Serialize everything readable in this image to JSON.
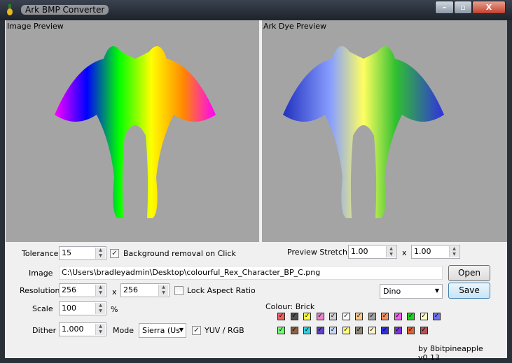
{
  "window": {
    "title": "Ark BMP Converter",
    "minimize": "–",
    "maximize": "▫",
    "close": "X"
  },
  "preview": {
    "image_label": "Image Preview",
    "dye_label": "Ark Dye Preview"
  },
  "controls": {
    "tolerance_label": "Tolerance",
    "tolerance": "15",
    "bg_removal_label": "Background removal on Click",
    "bg_removal_checked": true,
    "image_label": "Image",
    "image_path": "C:\\Users\\bradleyadmin\\Desktop\\colourful_Rex_Character_BP_C.png",
    "resolution_label": "Resolution",
    "res_w": "256",
    "x_label": "x",
    "res_h": "256",
    "lock_aspect_label": "Lock Aspect Ratio",
    "lock_aspect_checked": false,
    "scale_label": "Scale",
    "scale": "100",
    "percent": "%",
    "dither_label": "Dither",
    "dither": "1.000",
    "mode_label": "Mode",
    "mode": "Sierra (Us",
    "yuv_label": "YUV / RGB",
    "yuv_checked": true,
    "stretch_label": "Preview Stretch",
    "stretch_x": "1.00",
    "stretch_y": "1.00",
    "open": "Open",
    "save": "Save",
    "type": "Dino",
    "colour_label": "Colour: Brick",
    "footer": "by 8bitpineapple v0.13"
  },
  "swatches": [
    [
      "#ef6060",
      "#505050",
      "#ffff40",
      "#f080d0",
      "#d0d0d0",
      "#ffffff",
      "#ffc888",
      "#a0a0a0",
      "#f09060",
      "#f060f0",
      "#20d020",
      "#ffffc8",
      "#7070f0"
    ],
    [
      "#70ff70",
      "#906040",
      "#30d0e0",
      "#6040d0",
      "#c8d8ff",
      "#ffff80",
      "#908878",
      "#fff4c8",
      "#3030e0",
      "#8030e0",
      "#e06030",
      "#c05050"
    ]
  ]
}
